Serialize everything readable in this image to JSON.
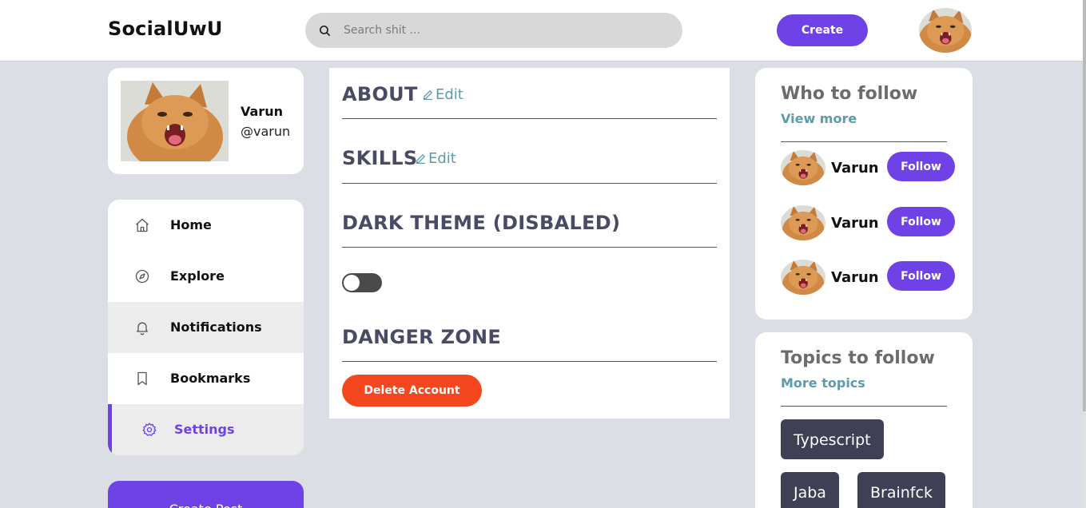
{
  "header": {
    "brand": "SocialUwU",
    "search_placeholder": "Search shit ...",
    "create_label": "Create"
  },
  "profile": {
    "name": "Varun",
    "handle": "@varun"
  },
  "nav": {
    "items": [
      {
        "label": "Home",
        "icon": "home-icon"
      },
      {
        "label": "Explore",
        "icon": "compass-icon"
      },
      {
        "label": "Notifications",
        "icon": "bell-icon"
      },
      {
        "label": "Bookmarks",
        "icon": "bookmark-icon"
      },
      {
        "label": "Settings",
        "icon": "gear-icon"
      }
    ],
    "active": "Settings",
    "create_post_label": "Create Post"
  },
  "settings": {
    "about_title": "ABOUT",
    "skills_title": "SKILLS",
    "edit_label": "Edit",
    "dark_theme_title": "DARK THEME (DISBALED)",
    "dark_theme_on": false,
    "danger_title": "DANGER ZONE",
    "delete_label": "Delete Account"
  },
  "who_to_follow": {
    "title": "Who to follow",
    "view_more": "View more",
    "users": [
      {
        "name": "Varun",
        "button": "Follow"
      },
      {
        "name": "Varun",
        "button": "Follow"
      },
      {
        "name": "Varun",
        "button": "Follow"
      }
    ]
  },
  "topics": {
    "title": "Topics to follow",
    "more": "More topics",
    "tags": [
      "Typescript",
      "Jaba",
      "Brainfck"
    ]
  },
  "colors": {
    "accent": "#6f42e8",
    "danger": "#f4461f",
    "link": "#5b9bab",
    "tag_bg": "#3f3f55"
  }
}
